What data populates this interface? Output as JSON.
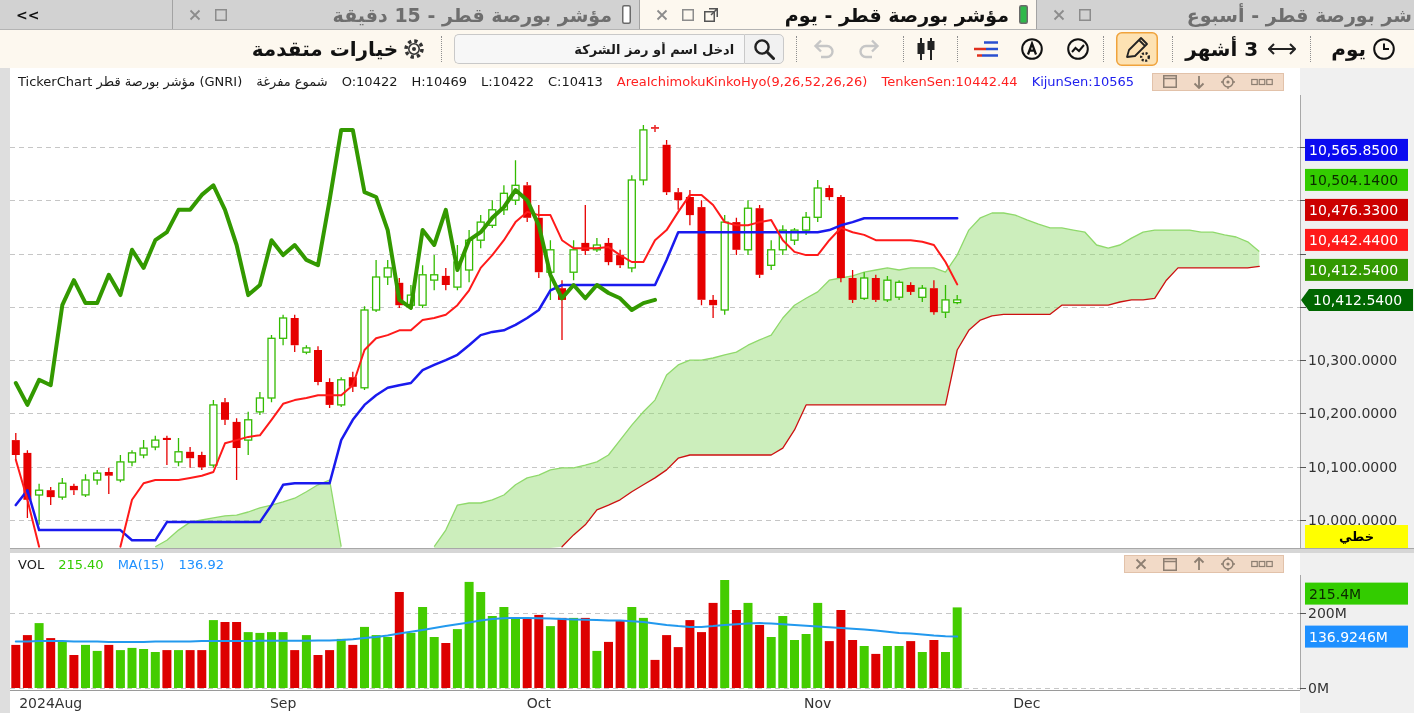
{
  "tab_bar": {
    "scroll_button": "<<",
    "tabs": [
      {
        "label": "شر بورصة قطر - أسبوع",
        "selected": false
      },
      {
        "label": "مؤشر بورصة قطر - يوم",
        "selected": true,
        "color": "#2fb84a"
      },
      {
        "label": "مؤشر بورصة قطر - 15 دقيقة",
        "selected": false,
        "color": "#ffffff"
      }
    ]
  },
  "toolbar": {
    "interval": "يوم",
    "range": "3 أشهر",
    "drawing_mode": {
      "on": true
    },
    "undo": {
      "disabled": true
    },
    "redo": {
      "disabled": true
    },
    "search": {
      "placeholder": "ادخل اسم أو رمز الشركة"
    },
    "advanced_options": "خيارات متقدمة"
  },
  "price_panel": {
    "legend": [
      {
        "text": "TickerChart مؤشر بورصة قطر (GNRI)",
        "color": "#1a1a1a"
      },
      {
        "text": "شموع مفرغة",
        "color": "#1a1a1a"
      },
      {
        "text": "O:10422",
        "color": "#1a1a1a"
      },
      {
        "text": "H:10469",
        "color": "#1a1a1a"
      },
      {
        "text": "L:10422",
        "color": "#1a1a1a"
      },
      {
        "text": "C:10413",
        "color": "#1a1a1a"
      },
      {
        "text": "AreaIchimokuKinkoHyo(9,26,52,26,26)",
        "color": "#ff2020"
      },
      {
        "text": "TenkenSen:10442.44",
        "color": "#ff2020"
      },
      {
        "text": "KijunSen:10565",
        "color": "#2020ee"
      }
    ],
    "chart_data": {
      "type": "candlestick",
      "categories": [
        null,
        null,
        null,
        null,
        null,
        null,
        null,
        null,
        null,
        null,
        null,
        null,
        null,
        null,
        null,
        null,
        null,
        null,
        null,
        null,
        null,
        null,
        null,
        null,
        null,
        null,
        null,
        null,
        null,
        null,
        null,
        null,
        null,
        null,
        null,
        null,
        null,
        null,
        null,
        null,
        null,
        null,
        null,
        null,
        null,
        null,
        null,
        null,
        null,
        null,
        null,
        null,
        null,
        null,
        null,
        null,
        null,
        null,
        null,
        null,
        null,
        null,
        null,
        null,
        null,
        null,
        null,
        null,
        null,
        null,
        null,
        null,
        null,
        null,
        null,
        null,
        null,
        null,
        null,
        null,
        null,
        null,
        null,
        null,
        null,
        null,
        null,
        null,
        null,
        null,
        null,
        null,
        null,
        null,
        null,
        null,
        null,
        null,
        null,
        null,
        null,
        null,
        null,
        null,
        null,
        null,
        null,
        null,
        null,
        null,
        null
      ],
      "ylim": [
        9947.5,
        10797.4
      ],
      "yticks": [
        {
          "value": 10000,
          "label": "10,000.0000"
        },
        {
          "value": 10100,
          "label": "10,100.0000"
        },
        {
          "value": 10200,
          "label": "10,200.0000"
        },
        {
          "value": 10300,
          "label": "10,300.0000"
        }
      ],
      "grid": true,
      "ohlc": [
        [
          10150,
          10163,
          10113,
          10122
        ],
        [
          10126,
          10131,
          10004,
          10038
        ],
        [
          10047,
          10068,
          9991,
          10056
        ],
        [
          10056,
          10062,
          10028,
          10043
        ],
        [
          10043,
          10079,
          10038,
          10069
        ],
        [
          10064,
          10068,
          10047,
          10056
        ],
        [
          10047,
          10086,
          10043,
          10075
        ],
        [
          10075,
          10094,
          10066,
          10088
        ],
        [
          10090,
          10098,
          10049,
          10083
        ],
        [
          10075,
          10122,
          10071,
          10109
        ],
        [
          10109,
          10131,
          10101,
          10126
        ],
        [
          10122,
          10150,
          10116,
          10135
        ],
        [
          10137,
          10158,
          10131,
          10150
        ],
        [
          10154,
          10158,
          10103,
          10150
        ],
        [
          10109,
          10154,
          10101,
          10128
        ],
        [
          10128,
          10137,
          10098,
          10116
        ],
        [
          10122,
          10128,
          10094,
          10099
        ],
        [
          10103,
          10225,
          10098,
          10216
        ],
        [
          10221,
          10229,
          10178,
          10188
        ],
        [
          10184,
          10191,
          10075,
          10135
        ],
        [
          10150,
          10203,
          10122,
          10188
        ],
        [
          10203,
          10240,
          10197,
          10229
        ],
        [
          10229,
          10347,
          10221,
          10341
        ],
        [
          10341,
          10385,
          10328,
          10379
        ],
        [
          10379,
          10385,
          10315,
          10328
        ],
        [
          10315,
          10328,
          10311,
          10323
        ],
        [
          10319,
          10326,
          10253,
          10259
        ],
        [
          10259,
          10266,
          10210,
          10216
        ],
        [
          10216,
          10268,
          10212,
          10263
        ],
        [
          10268,
          10278,
          10240,
          10250
        ],
        [
          10248,
          10401,
          10244,
          10394
        ],
        [
          10394,
          10488,
          10390,
          10456
        ],
        [
          10456,
          10488,
          10441,
          10473
        ],
        [
          10445,
          10454,
          10398,
          10403
        ],
        [
          10403,
          10441,
          10394,
          10422
        ],
        [
          10403,
          10478,
          10398,
          10460
        ],
        [
          10450,
          10497,
          10431,
          10460
        ],
        [
          10458,
          10473,
          10431,
          10441
        ],
        [
          10437,
          10516,
          10431,
          10484
        ],
        [
          10469,
          10544,
          10446,
          10525
        ],
        [
          10525,
          10572,
          10510,
          10559
        ],
        [
          10553,
          10600,
          10548,
          10582
        ],
        [
          10582,
          10628,
          10572,
          10613
        ],
        [
          10600,
          10675,
          10591,
          10628
        ],
        [
          10628,
          10634,
          10559,
          10567
        ],
        [
          10567,
          10591,
          10454,
          10465
        ],
        [
          10465,
          10525,
          10413,
          10507
        ],
        [
          10435,
          10450,
          10338,
          10413
        ],
        [
          10465,
          10525,
          10450,
          10507
        ],
        [
          10520,
          10591,
          10497,
          10505
        ],
        [
          10507,
          10529,
          10503,
          10516
        ],
        [
          10520,
          10529,
          10478,
          10484
        ],
        [
          10497,
          10507,
          10473,
          10478
        ],
        [
          10473,
          10647,
          10465,
          10638
        ],
        [
          10638,
          10741,
          10628,
          10732
        ],
        [
          10737,
          10741,
          10728,
          10735
        ],
        [
          10704,
          10713,
          10610,
          10615
        ],
        [
          10615,
          10623,
          10582,
          10600
        ],
        [
          10606,
          10619,
          10553,
          10572
        ],
        [
          10587,
          10600,
          10403,
          10413
        ],
        [
          10413,
          10422,
          10379,
          10403
        ],
        [
          10394,
          10572,
          10385,
          10559
        ],
        [
          10559,
          10567,
          10497,
          10507
        ],
        [
          10507,
          10600,
          10497,
          10585
        ],
        [
          10585,
          10591,
          10454,
          10460
        ],
        [
          10478,
          10525,
          10469,
          10507
        ],
        [
          10507,
          10553,
          10497,
          10544
        ],
        [
          10525,
          10548,
          10516,
          10544
        ],
        [
          10544,
          10578,
          10535,
          10568
        ],
        [
          10568,
          10638,
          10559,
          10623
        ],
        [
          10623,
          10628,
          10600,
          10606
        ],
        [
          10606,
          10610,
          10446,
          10454
        ],
        [
          10454,
          10469,
          10407,
          10413
        ],
        [
          10416,
          10465,
          10413,
          10454
        ],
        [
          10454,
          10460,
          10409,
          10413
        ],
        [
          10413,
          10458,
          10409,
          10450
        ],
        [
          10418,
          10450,
          10413,
          10446
        ],
        [
          10441,
          10446,
          10422,
          10428
        ],
        [
          10418,
          10441,
          10409,
          10435
        ],
        [
          10435,
          10450,
          10385,
          10390
        ],
        [
          10390,
          10441,
          10379,
          10413
        ],
        [
          10408,
          10422,
          10405,
          10413
        ],
        null,
        null,
        null,
        null,
        null,
        null,
        null,
        null,
        null,
        null,
        null,
        null,
        null,
        null,
        null,
        null,
        null,
        null,
        null,
        null,
        null,
        null,
        null,
        null,
        null,
        null,
        null,
        null,
        null
      ],
      "series": [
        {
          "type": "line",
          "color": "#1a1aee",
          "values": [
            10028,
            10056,
            9981,
            9981,
            9981,
            9981,
            9981,
            9981,
            9981,
            9981,
            9962,
            9962,
            9962,
            9996,
            9996,
            9996,
            9996,
            9996,
            9996,
            9996,
            9996,
            9996,
            10028,
            10066,
            10069,
            10069,
            10069,
            10069,
            10150,
            10188,
            10216,
            10234,
            10248,
            10253,
            10257,
            10281,
            10291,
            10300,
            10310,
            10328,
            10347,
            10353,
            10356,
            10366,
            10379,
            10394,
            10431,
            10441,
            10441,
            10441,
            10441,
            10441,
            10441,
            10441,
            10441,
            10441,
            10488,
            10540,
            10540,
            10540,
            10540,
            10540,
            10540,
            10540,
            10540,
            10540,
            10540,
            10540,
            10540,
            10540,
            10544,
            10553,
            10559,
            10566,
            10566,
            10566,
            10566,
            10566,
            10566,
            10566,
            10566,
            10566,
            null,
            null,
            null,
            null,
            null,
            null,
            null,
            null,
            null,
            null,
            null,
            null,
            null,
            null,
            null,
            null,
            null,
            null,
            null,
            null,
            null,
            null,
            null,
            null,
            null,
            null,
            null,
            null,
            null
          ]
        },
        {
          "type": "line",
          "color": "#ff1a1a",
          "values": [
            10113,
            10038,
            9950,
            null,
            null,
            null,
            null,
            null,
            null,
            9950,
            10038,
            10069,
            10075,
            10075,
            10075,
            10079,
            10083,
            10090,
            10144,
            10150,
            10156,
            10159,
            10188,
            10218,
            10225,
            10229,
            10234,
            10234,
            10234,
            10253,
            10319,
            10341,
            10347,
            10356,
            10356,
            10375,
            10379,
            10385,
            10403,
            10431,
            10473,
            10497,
            10525,
            10559,
            10578,
            10572,
            10572,
            10525,
            10510,
            10510,
            10510,
            10512,
            10497,
            10484,
            10484,
            10525,
            10544,
            10578,
            10610,
            10610,
            10591,
            10559,
            10553,
            10553,
            10559,
            10563,
            10525,
            10503,
            10497,
            10497,
            10525,
            10548,
            10540,
            10535,
            10525,
            10525,
            10525,
            10525,
            10522,
            10516,
            10484,
            10442,
            null,
            null,
            null,
            null,
            null,
            null,
            null,
            null,
            null,
            null,
            null,
            null,
            null,
            null,
            null,
            null,
            null,
            null,
            null,
            null,
            null,
            null,
            null,
            null,
            null,
            null,
            null,
            null,
            null
          ]
        },
        {
          "type": "line",
          "color": "#339900",
          "values": [
            10257,
            10216,
            10263,
            10253,
            10403,
            10450,
            10407,
            10407,
            10460,
            10422,
            10507,
            10473,
            10525,
            10540,
            10582,
            10582,
            10610,
            10628,
            10582,
            10516,
            10422,
            10441,
            10525,
            10497,
            10516,
            10488,
            10478,
            10600,
            10732,
            10732,
            10615,
            10606,
            10544,
            10413,
            10398,
            10544,
            10516,
            10582,
            10469,
            10525,
            10540,
            10567,
            10587,
            10619,
            10600,
            10553,
            10460,
            10416,
            10441,
            10416,
            10441,
            10426,
            10416,
            10394,
            10407,
            10413,
            null,
            null,
            null,
            null,
            null,
            null,
            null,
            null,
            null,
            null,
            null,
            null,
            null,
            null,
            null,
            null,
            null,
            null,
            null,
            null,
            null,
            null,
            null,
            null,
            null,
            null,
            null,
            null,
            null,
            null,
            null,
            null,
            null,
            null,
            null,
            null,
            null,
            null,
            null,
            null,
            null,
            null,
            null,
            null,
            null,
            null,
            null,
            null,
            null,
            null,
            null,
            null,
            null,
            null,
            null
          ]
        },
        {
          "type": "area",
          "color": "#8fd96b",
          "values": [
            null,
            null,
            null,
            null,
            null,
            null,
            null,
            null,
            null,
            null,
            null,
            null,
            9950,
            9962,
            9981,
            9996,
            10000,
            10004,
            10008,
            10009,
            10015,
            10023,
            10028,
            10034,
            10041,
            10053,
            10066,
            10075,
            9950,
            null,
            null,
            null,
            null,
            null,
            null,
            null,
            null,
            null,
            null,
            null,
            null,
            null,
            null,
            null,
            null,
            null,
            null,
            null,
            null,
            null,
            null,
            null,
            null,
            null,
            null,
            null,
            null,
            null,
            null,
            null,
            null,
            null,
            null,
            null,
            null,
            null,
            null,
            null,
            null,
            null,
            null,
            null,
            null,
            null,
            null,
            null,
            null,
            null,
            null,
            null,
            null,
            null,
            null,
            null,
            null,
            null,
            null,
            null,
            null,
            null,
            null,
            null,
            null,
            null,
            null,
            null,
            null,
            null,
            null,
            null,
            null,
            null,
            null,
            null,
            null,
            null,
            null,
            null,
            null,
            null,
            null
          ]
        },
        {
          "type": "area",
          "color": "#8fd96b",
          "values": [
            null,
            null,
            null,
            null,
            null,
            null,
            null,
            null,
            null,
            null,
            null,
            null,
            null,
            null,
            null,
            null,
            null,
            null,
            null,
            null,
            null,
            null,
            null,
            null,
            null,
            null,
            null,
            null,
            null,
            null,
            null,
            null,
            null,
            null,
            null,
            null,
            9950,
            9981,
            10028,
            10032,
            10032,
            10038,
            10047,
            10066,
            10079,
            10084,
            10094,
            10098,
            10098,
            10103,
            10109,
            10122,
            10150,
            10178,
            10203,
            10225,
            10272,
            10291,
            10300,
            10300,
            10304,
            10310,
            10315,
            10328,
            10338,
            10347,
            10379,
            10403,
            10416,
            10428,
            10450,
            10454,
            10458,
            10465,
            10469,
            10473,
            10469,
            10473,
            10473,
            10473,
            10465,
            10497,
            10544,
            10567,
            10576,
            10576,
            10572,
            10563,
            10555,
            10548,
            10548,
            10544,
            10540,
            10516,
            10510,
            10516,
            10529,
            10540,
            10544,
            10544,
            10544,
            10544,
            10540,
            10540,
            10535,
            10531,
            10522,
            10504,
            null,
            null,
            null
          ]
        },
        {
          "type": "line",
          "color": "#cc1111",
          "values": [
            null,
            null,
            null,
            null,
            null,
            null,
            null,
            null,
            null,
            null,
            null,
            null,
            null,
            null,
            null,
            null,
            null,
            null,
            null,
            null,
            null,
            null,
            null,
            null,
            null,
            null,
            null,
            null,
            null,
            null,
            null,
            null,
            null,
            null,
            null,
            null,
            null,
            null,
            null,
            null,
            null,
            null,
            null,
            null,
            null,
            null,
            null,
            9950,
            9972,
            9991,
            10019,
            10028,
            10038,
            10053,
            10066,
            10079,
            10094,
            10116,
            10122,
            10122,
            10122,
            10122,
            10122,
            10122,
            10122,
            10122,
            10135,
            10169,
            10216,
            10216,
            10216,
            10216,
            10216,
            10216,
            10216,
            10216,
            10216,
            10216,
            10216,
            10216,
            10216,
            10319,
            10356,
            10375,
            10383,
            10386,
            10386,
            10386,
            10386,
            10386,
            10403,
            10403,
            10403,
            10403,
            10403,
            10409,
            10413,
            10413,
            10416,
            10450,
            10473,
            10473,
            10473,
            10473,
            10473,
            10473,
            10473,
            10476,
            null,
            null,
            null
          ]
        }
      ]
    },
    "price_labels": [
      {
        "text": "10,565.8500",
        "color": "#0a0af0",
        "kind": "box"
      },
      {
        "text": "10,504.1400",
        "color": "#33cc00",
        "kind": "box"
      },
      {
        "text": "10,476.3300",
        "color": "#cc0000",
        "kind": "box"
      },
      {
        "text": "10,442.4400",
        "color": "#ff1a1a",
        "kind": "box"
      },
      {
        "text": "10,412.5400",
        "color": "#339900",
        "kind": "box"
      },
      {
        "text": "10,412.5400",
        "color": "#006600",
        "kind": "arrow"
      }
    ],
    "scale_button": "خطي"
  },
  "volume_panel": {
    "legend": [
      {
        "text": "VOL",
        "color": "#1a1a1a"
      },
      {
        "text": "215.40",
        "color": "#33cc00"
      },
      {
        "text": "MA(15)",
        "color": "#1e90ff"
      },
      {
        "text": "136.92",
        "color": "#1e90ff"
      }
    ],
    "chart_data": {
      "type": "bar",
      "stacked": true,
      "ylim": [
        -5.3,
        301.3
      ],
      "yticks": [
        {
          "value": 0,
          "label": "0M"
        },
        {
          "value": 200,
          "label": "200M"
        }
      ],
      "grid": true,
      "categories": [
        null,
        null,
        null,
        "2024Aug",
        null,
        null,
        null,
        null,
        null,
        null,
        null,
        null,
        null,
        null,
        null,
        null,
        null,
        null,
        null,
        null,
        null,
        null,
        null,
        "Sep",
        null,
        null,
        null,
        null,
        null,
        null,
        null,
        null,
        null,
        null,
        null,
        null,
        null,
        null,
        null,
        null,
        null,
        null,
        null,
        null,
        null,
        "Oct",
        null,
        null,
        null,
        null,
        null,
        null,
        null,
        null,
        null,
        null,
        null,
        null,
        null,
        null,
        null,
        null,
        null,
        null,
        null,
        null,
        null,
        null,
        null,
        "Nov",
        null,
        null,
        null,
        null,
        null,
        null,
        null,
        null,
        null,
        null,
        null,
        null,
        null,
        null,
        null,
        null,
        null,
        "Dec",
        null,
        null,
        null,
        null,
        null,
        null,
        null,
        null,
        null,
        null,
        null,
        null,
        null,
        null,
        null,
        null,
        null,
        null,
        null,
        null,
        null,
        null,
        null
      ],
      "series": [
        {
          "color": "#44cc00",
          "values": [
            null,
            null,
            173,
            null,
            125,
            null,
            115,
            99,
            null,
            101,
            107,
            104,
            96,
            null,
            101,
            null,
            null,
            181,
            null,
            null,
            149,
            147,
            149,
            149,
            null,
            141,
            null,
            null,
            131,
            null,
            163,
            141,
            136,
            null,
            147,
            216,
            136,
            null,
            157,
            283,
            256,
            192,
            216,
            184,
            null,
            null,
            165,
            null,
            187,
            null,
            99,
            null,
            null,
            216,
            187,
            null,
            null,
            null,
            null,
            null,
            null,
            288,
            null,
            227,
            null,
            136,
            192,
            128,
            144,
            227,
            null,
            null,
            null,
            112,
            null,
            112,
            112,
            null,
            96,
            null,
            96,
            215,
            null,
            null,
            null,
            null,
            null,
            null,
            null,
            null,
            null,
            null,
            null,
            null,
            null,
            null,
            null,
            null,
            null,
            null,
            null,
            null,
            null,
            null,
            null,
            null,
            null,
            null,
            null,
            null,
            null
          ]
        },
        {
          "color": "#dd0000",
          "values": [
            115,
            141,
            null,
            133,
            null,
            88,
            null,
            null,
            115,
            null,
            null,
            null,
            null,
            101,
            null,
            101,
            101,
            null,
            176,
            176,
            null,
            null,
            null,
            null,
            101,
            null,
            88,
            101,
            null,
            115,
            null,
            null,
            null,
            256,
            null,
            null,
            null,
            120,
            null,
            null,
            null,
            null,
            null,
            null,
            187,
            195,
            null,
            187,
            null,
            187,
            null,
            123,
            181,
            null,
            null,
            75,
            141,
            109,
            181,
            149,
            227,
            null,
            208,
            null,
            168,
            null,
            null,
            null,
            null,
            null,
            125,
            208,
            128,
            null,
            91,
            null,
            null,
            125,
            null,
            128,
            null,
            null,
            null,
            null,
            null,
            null,
            null,
            null,
            null,
            null,
            null,
            null,
            null,
            null,
            null,
            null,
            null,
            null,
            null,
            null,
            null,
            null,
            null,
            null,
            null,
            null,
            null,
            null,
            null,
            null,
            null
          ]
        },
        {
          "type": "line",
          "color": "#2299ee",
          "values": [
            124,
            124,
            125,
            125,
            125,
            124,
            124,
            124,
            123,
            123,
            123,
            123,
            124,
            124,
            124,
            124,
            125,
            125,
            125,
            125,
            125,
            126,
            126,
            126,
            126,
            126,
            127,
            127,
            128,
            130,
            133,
            136,
            140,
            145,
            150,
            155,
            160,
            165,
            170,
            175,
            180,
            184,
            186,
            187,
            187,
            186,
            185,
            184,
            183,
            182,
            181,
            180,
            180,
            178,
            176,
            172,
            168,
            165,
            163,
            163,
            165,
            168,
            170,
            172,
            173,
            172,
            170,
            168,
            166,
            164,
            162,
            160,
            158,
            156,
            153,
            150,
            147,
            145,
            143,
            140,
            138,
            137,
            null,
            null,
            null,
            null,
            null,
            null,
            null,
            null,
            null,
            null,
            null,
            null,
            null,
            null,
            null,
            null,
            null,
            null,
            null,
            null,
            null,
            null,
            null,
            null,
            null,
            null,
            null,
            null,
            null
          ]
        }
      ]
    },
    "value_labels": [
      {
        "text": "215.4M",
        "color": "#33cc00"
      },
      {
        "text": "136.9246M",
        "color": "#1e90ff"
      }
    ]
  }
}
